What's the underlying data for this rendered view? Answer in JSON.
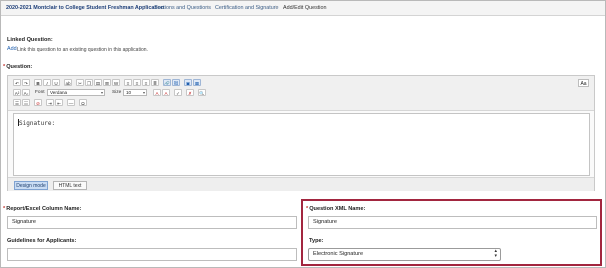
{
  "breadcrumb": {
    "items": [
      "2020-2021 Montclair to College Student Freshman Application",
      "Sections and Questions",
      "Certification and Signature",
      "Add/Edit Question"
    ]
  },
  "linked_question": {
    "label": "Linked Question:",
    "add_link": "Add",
    "help": "Link this question to an existing question in this application."
  },
  "question": {
    "required_mark": "*",
    "label": "Question:",
    "content": "Signature:"
  },
  "toolbar": {
    "font_label": "Font",
    "font_value": "Verdana",
    "size_label": "Size",
    "size_value": "10",
    "aa_label": "Aa"
  },
  "editor_modes": {
    "design": "Design mode",
    "html": "HTML text"
  },
  "report_column": {
    "required_mark": "*",
    "label": "Report/Excel Column Name:",
    "value": "Signature"
  },
  "guidelines": {
    "label": "Guidelines for Applicants:",
    "value": ""
  },
  "xml_name": {
    "required_mark": "*",
    "label": "Question XML Name:",
    "value": "Signature"
  },
  "type": {
    "label": "Type:",
    "selected": "Electronic Signature"
  },
  "colors": {
    "highlight": "#a2263f",
    "required": "#c0302b",
    "link": "#1f5fae"
  }
}
